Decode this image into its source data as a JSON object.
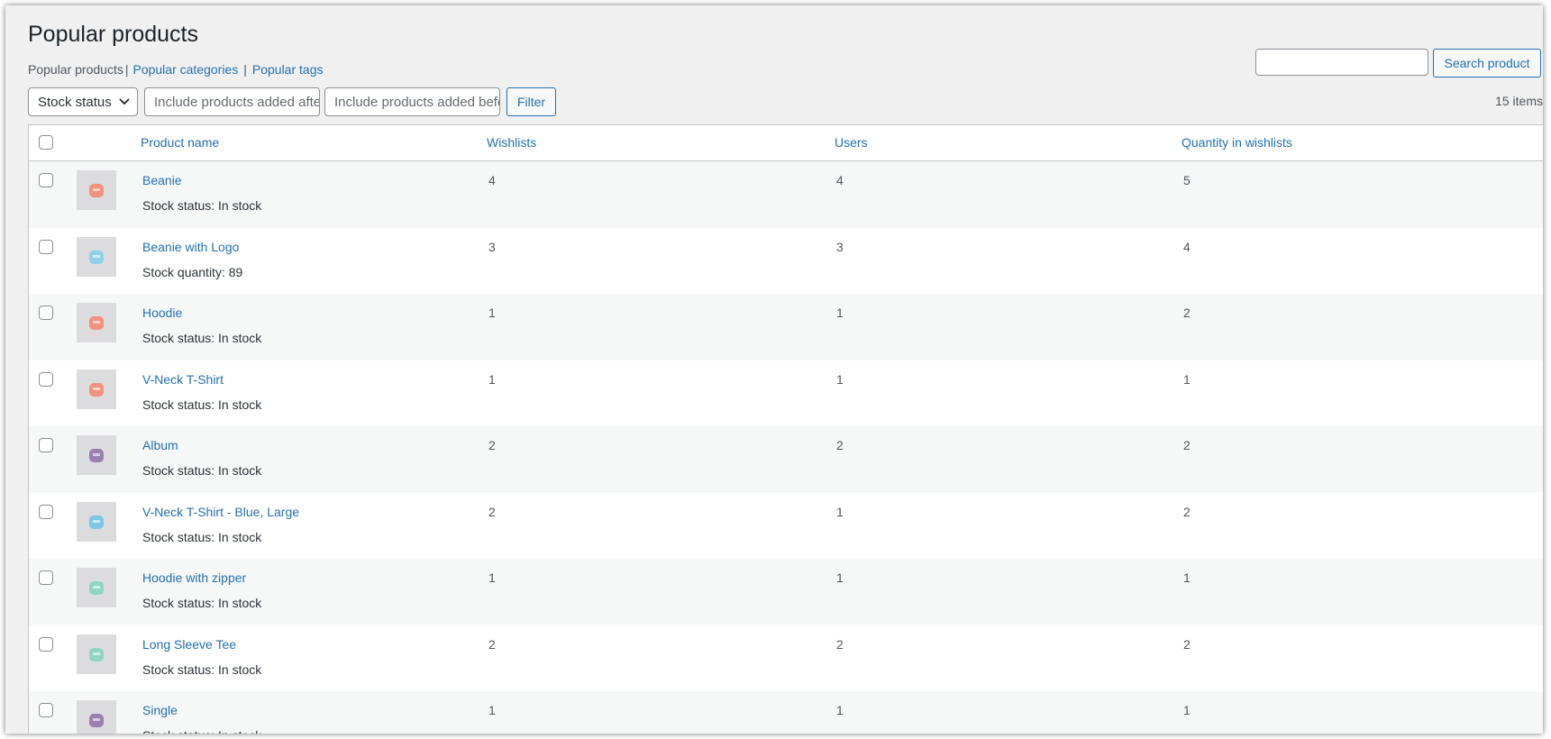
{
  "page": {
    "title": "Popular products",
    "views": {
      "current": "Popular products",
      "links": [
        "Popular categories",
        "Popular tags"
      ],
      "separator": "|"
    },
    "search": {
      "value": "",
      "button_label": "Search product"
    },
    "filters": {
      "stock_status_label": "Stock status",
      "date_from_placeholder": "Include products added after",
      "date_to_placeholder": "Include products added before",
      "filter_label": "Filter"
    },
    "items_count": "15 items"
  },
  "table": {
    "columns": [
      "Product name",
      "Wishlists",
      "Users",
      "Quantity in wishlists"
    ],
    "rows": [
      {
        "name": "Beanie",
        "stock": "Stock status: In stock",
        "wishlists": "4",
        "users": "4",
        "qty": "5",
        "icon": "beanie-icon",
        "color": "#f2917e"
      },
      {
        "name": "Beanie with Logo",
        "stock": "Stock quantity: 89",
        "wishlists": "3",
        "users": "3",
        "qty": "4",
        "icon": "beanie-logo-icon",
        "color": "#8fd0e6"
      },
      {
        "name": "Hoodie",
        "stock": "Stock status: In stock",
        "wishlists": "1",
        "users": "1",
        "qty": "2",
        "icon": "hoodie-icon",
        "color": "#f2917e"
      },
      {
        "name": "V-Neck T-Shirt",
        "stock": "Stock status: In stock",
        "wishlists": "1",
        "users": "1",
        "qty": "1",
        "icon": "tshirt-icon",
        "color": "#f2917e"
      },
      {
        "name": "Album",
        "stock": "Stock status: In stock",
        "wishlists": "2",
        "users": "2",
        "qty": "2",
        "icon": "album-icon",
        "color": "#9b7fb3"
      },
      {
        "name": "V-Neck T-Shirt - Blue, Large",
        "stock": "Stock status: In stock",
        "wishlists": "2",
        "users": "1",
        "qty": "2",
        "icon": "tshirt-blue-icon",
        "color": "#7ec7e6"
      },
      {
        "name": "Hoodie with zipper",
        "stock": "Stock status: In stock",
        "wishlists": "1",
        "users": "1",
        "qty": "1",
        "icon": "hoodie-zipper-icon",
        "color": "#8fd6c0"
      },
      {
        "name": "Long Sleeve Tee",
        "stock": "Stock status: In stock",
        "wishlists": "2",
        "users": "2",
        "qty": "2",
        "icon": "longsleeve-icon",
        "color": "#8fd6c0"
      },
      {
        "name": "Single",
        "stock": "Stock status: In stock",
        "wishlists": "1",
        "users": "1",
        "qty": "1",
        "icon": "single-icon",
        "color": "#9b7fb3"
      }
    ]
  },
  "colors": {
    "link": "#2271b1",
    "bg": "#f0f0f1",
    "row_alt": "#f6f7f7",
    "border": "#c3c4c7"
  }
}
